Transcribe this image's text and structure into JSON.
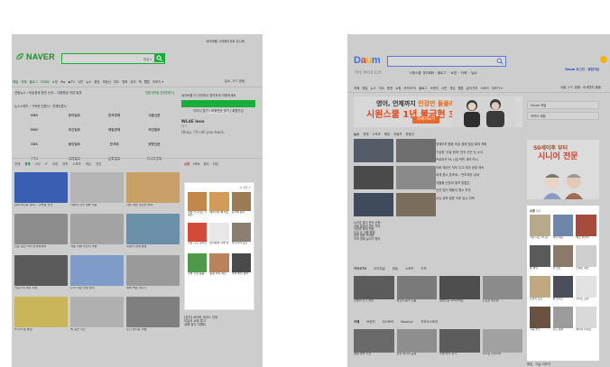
{
  "naver": {
    "logo": "NAVER",
    "top_links": "네이버를 시작페이지로 쥬니버",
    "search_placeholder": "",
    "search_extra": "한글 ▾",
    "menu": [
      "메일",
      "카페",
      "블로그",
      "지식iN",
      "쇼핑",
      "Pay",
      "▶TV",
      "사전",
      "뉴스",
      "증권",
      "부동산",
      "지도",
      "영화",
      "뮤직",
      "책",
      "웹툰",
      "더보기 ▾"
    ],
    "weather": "날씨 -3°C 흐림",
    "news_line1": "연합뉴스 › 비상경제 현안 논의... 대한항공 관련 발표",
    "news_line1_right": "언론사편집 전체언론사",
    "news_line2": "뉴스스탠드 › 구독한 언론사 · 전체언론사",
    "press_logos": [
      "KBS",
      "동아일보",
      "한국경제",
      "서울신문",
      "MBC",
      "조선일보",
      "매일경제",
      "국민일보",
      "SBS",
      "중앙일보",
      "한겨레",
      "경향신문",
      "YTN",
      "세계일보",
      "문화일보",
      "아시아경제"
    ],
    "login_desc": "네이버를 더 안전하고 편리하게 이용하세요",
    "login_button": "NAVER 로그인",
    "login_links": "아이디 찾기 | 비밀번호 찾기 | 회원가입",
    "card_title": "WL4E lens",
    "card_sub": "Okay, I'll call you back.",
    "card_ad": "광고",
    "tabs": [
      "전체",
      "경제",
      "시사",
      "IT",
      "리빙",
      "과학",
      "스포츠",
      "게임",
      "건강"
    ],
    "tab_active": "경제",
    "tiles": [
      {
        "cap": "입덕 포인트 정리... 주목할 신작",
        "color": "#3a5fb2"
      },
      {
        "cap": "사랑의 인사 영화 리뷰",
        "color": "#b4b4b4"
      },
      {
        "cap": "나를 위한 맛있는 한끼",
        "color": "#c8a067"
      },
      {
        "cap": "연말 정산 미리 준비하세요",
        "color": "#8c8c8c"
      },
      {
        "cap": "겨울 여행 추천지 모음",
        "color": "#a3a3a3"
      },
      {
        "cap": "오늘의 경제 동향",
        "color": "#6b8fa8"
      },
      {
        "cap": "사업가의 하루 루틴",
        "color": "#5a5a5a"
      },
      {
        "cap": "주식 시장 전망 정리",
        "color": "#7e9cc7"
      },
      {
        "cap": "새해 목표 세우기",
        "color": "#9a9a9a"
      },
      {
        "cap": "도시의 밤 풍경",
        "color": "#c9b55a"
      },
      {
        "cap": "책 읽는 시간",
        "color": "#b0b0b0"
      },
      {
        "cap": "주간 핫이슈 모음",
        "color": "#7f7f7f"
      }
    ],
    "shop_tabs": [
      "쇼핑",
      "MEN",
      "뷰티",
      "리빙"
    ],
    "shop_active": "쇼핑",
    "shop_pager": "< 1/5 >",
    "shop_items": [
      {
        "cap": "겨울 스니커즈 기획전",
        "color": "#c2874b"
      },
      {
        "cap": "베이커리 빵 세트",
        "color": "#d39a58"
      },
      {
        "cap": "홈카페 원두",
        "color": "#9c7a53"
      },
      {
        "cap": "신상 니트 원피스",
        "color": "#d44a3a"
      },
      {
        "cap": "반려동물 겨울 옷",
        "color": "#e8e8e8"
      },
      {
        "cap": "캐시미어 코트",
        "color": "#8b7f72"
      },
      {
        "cap": "주방 수납 용품",
        "color": "#4f9a4a"
      },
      {
        "cap": "원목 식탁 세트",
        "color": "#b7825c"
      },
      {
        "cap": "겨울 패딩 점퍼",
        "color": "#4a4a4a"
      }
    ],
    "side_list": [
      "[공지] 네이버 서비스 안내",
      "오늘의 쇼핑 특가",
      "새해 맞이 이벤트"
    ]
  },
  "daum": {
    "logo": [
      "D",
      "a",
      "u",
      "m"
    ],
    "logo_sub": "카카오 계정으로 로그인",
    "search_placeholder": "",
    "under_links": "'시원스쿨' 영어회화 · '블로그' · '쇼핑' · '카페' · '날씨'",
    "login": "Daum 로그인 · 회원가입",
    "menu": [
      "카페",
      "메일",
      "뉴스",
      "지도",
      "증권",
      "쇼핑",
      "카카오TV",
      "블로그",
      "브런치",
      "사전",
      "게임",
      "웹툰",
      "같이가치",
      "스토리",
      "더보기 ▾"
    ],
    "weather": "서울 -2°C 맑음 · 미세먼지 좋음",
    "banner_l1a": "영어, 언제까지",
    "banner_l1b": " 인강만 들을래?",
    "banner_l2": "시원스쿨 1년 불금현 30%할인",
    "banner_cta": "자세히보기",
    "right_links": [
      "Daum 메일",
      "카카오 계정"
    ],
    "news_tabs": [
      "뉴스",
      "연예",
      "스포츠",
      "랭킹",
      "자동차",
      "부동산"
    ],
    "news_active": "뉴스",
    "news": [
      {
        "cap": "누리호 발사 준비 순항",
        "color": "#555b66"
      },
      {
        "cap": "국회 본회의 법안 처리",
        "color": "#6e6e6e"
      },
      {
        "cap": "의정부 화재 현장",
        "color": "#4a4a4a"
      },
      {
        "cap": "도심 속 겨울 풍경",
        "color": "#8a8a8a"
      },
      {
        "cap": "정부 합동 브리핑",
        "color": "#3f4a5a"
      },
      {
        "cap": "지역 경제 살리기 행사",
        "color": "#7a6d5c"
      }
    ],
    "news_list": [
      "경제부처 합동 비상 경제 점검 회의 개최",
      "기상청 '주말 한파' 전국 곳곳 눈 소식",
      "프로야구 FA 시장 막판 계약 러시",
      "국회 예산안 처리 두고 여야 공방 계속",
      "세계 증시 혼조세... 반도체주 강세",
      "겨울철 난방비 절약 방법은",
      "신년 맞이 해돋이 명소 추천",
      "수능 성적 발표 이후 입시 전략"
    ],
    "ad_l1": "50세이후 부터",
    "ad_l2": "시니어 전문",
    "shop_title": "쇼핑",
    "shop_pager": "1/4",
    "shop_items": [
      {
        "cap": "겨울 니트 카디건",
        "color": "#b9a98c"
      },
      {
        "cap": "데님 재킷",
        "color": "#6d85a8"
      },
      {
        "cap": "체크 머플러",
        "color": "#a44d3f"
      },
      {
        "cap": "롱 패딩",
        "color": "#5a5a5a"
      },
      {
        "cap": "울 코트",
        "color": "#8a7a6a"
      },
      {
        "cap": "스웨트 셔츠",
        "color": "#cfcfcf"
      },
      {
        "cap": "트렌치 코트",
        "color": "#c0a980"
      },
      {
        "cap": "롱 원피스",
        "color": "#4b4f5a"
      },
      {
        "cap": "플리스 집업",
        "color": "#e2e2e2"
      },
      {
        "cap": "가죽 부츠",
        "color": "#6b5240"
      },
      {
        "cap": "후드 점퍼",
        "color": "#9c9c9c"
      },
      {
        "cap": "베이직 티셔츠",
        "color": "#d9d9d9"
      }
    ],
    "tv_tabs": [
      "카카오TV",
      "오리지널",
      "방송",
      "스포츠",
      "키즈"
    ],
    "tv": [
      {
        "cap": "오늘의 인기 영상",
        "color": "#5b5b5b"
      },
      {
        "cap": "편안한 음악 모음",
        "color": "#7a7a7a"
      },
      {
        "cap": "알쓸신잡 하이라이트",
        "color": "#4e4e4e"
      },
      {
        "cap": "스포츠 명장면",
        "color": "#8b8b8b"
      }
    ],
    "cafe_tabs": [
      "카페",
      "브런치",
      "티스토리",
      "Moonlyn",
      "카카오스토리"
    ],
    "cafe": [
      {
        "cap": "캠핑 장비 추천",
        "color": "#6a6a6a"
      },
      {
        "cap": "반찬 레시피 공유",
        "color": "#8e8e8e"
      },
      {
        "cap": "주말 낚시 후기",
        "color": "#5c5c5c"
      },
      {
        "cap": "우리집 인테리어",
        "color": "#a1a1a1"
      }
    ],
    "bottom": "랭킹 · 이슈 더보기"
  }
}
